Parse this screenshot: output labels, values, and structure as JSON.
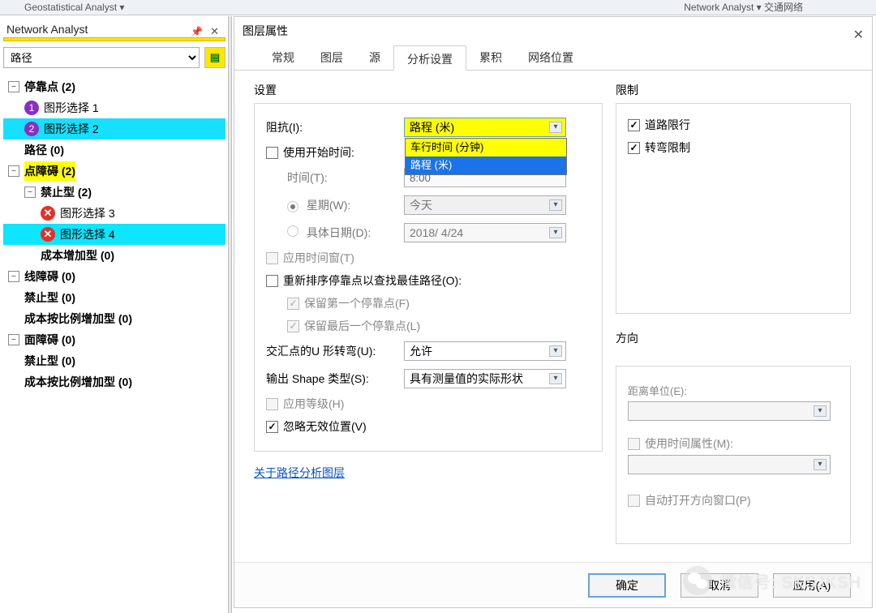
{
  "topstrip": {
    "left_text": "Geostatistical Analyst ▾",
    "right_text": "Network Analyst ▾   交通网络"
  },
  "na": {
    "title": "Network Analyst",
    "route_select": "路径",
    "tree": {
      "stops": "停靠点 (2)",
      "gs1": "图形选择 1",
      "gs2": "图形选择 2",
      "routes": "路径 (0)",
      "pt_barrier": "点障碍 (2)",
      "pt_ban": "禁止型 (2)",
      "gs3": "图形选择 3",
      "gs4": "图形选择 4",
      "cost_add": "成本增加型 (0)",
      "ln_barrier": "线障碍 (0)",
      "ln_ban": "禁止型 (0)",
      "ln_cost": "成本按比例增加型 (0)",
      "poly_barrier": "面障碍 (0)",
      "poly_ban": "禁止型 (0)",
      "poly_cost": "成本按比例增加型 (0)"
    }
  },
  "dialog": {
    "title": "图层属性",
    "tabs": [
      "常规",
      "图层",
      "源",
      "分析设置",
      "累积",
      "网络位置"
    ],
    "settings_label": "设置",
    "impedance_label": "阻抗(I):",
    "impedance_value": "路程 (米)",
    "impedance_options": {
      "o0": "车行时间 (分钟)",
      "o1": "路程 (米)"
    },
    "use_start": "使用开始时间:",
    "time_label": "时间(T):",
    "time_value": "8:00",
    "week_label": "星期(W):",
    "week_value": "今天",
    "date_label": "具体日期(D):",
    "date_value": "2018/ 4/24",
    "time_window": "应用时间窗(T)",
    "reorder": "重新排序停靠点以查找最佳路径(O):",
    "keep_first": "保留第一个停靠点(F)",
    "keep_last": "保留最后一个停靠点(L)",
    "uturn_label": "交汇点的U 形转弯(U):",
    "uturn_value": "允许",
    "shape_label": "输出 Shape 类型(S):",
    "shape_value": "具有测量值的实际形状",
    "hierarchy": "应用等级(H)",
    "ignore_invalid": "忽略无效位置(V)",
    "about_link": "关于路径分析图层",
    "restrict_label": "限制",
    "restrict_1": "道路限行",
    "restrict_2": "转弯限制",
    "direction_label": "方向",
    "dist_unit": "距离单位(E):",
    "use_time_attr": "使用时间属性(M):",
    "auto_open": "自动打开方向窗口(P)",
    "btn_ok": "确定",
    "btn_cancel": "取消",
    "btn_apply": "应用(A)"
  },
  "watermark": "微信号: SKSJKSH"
}
